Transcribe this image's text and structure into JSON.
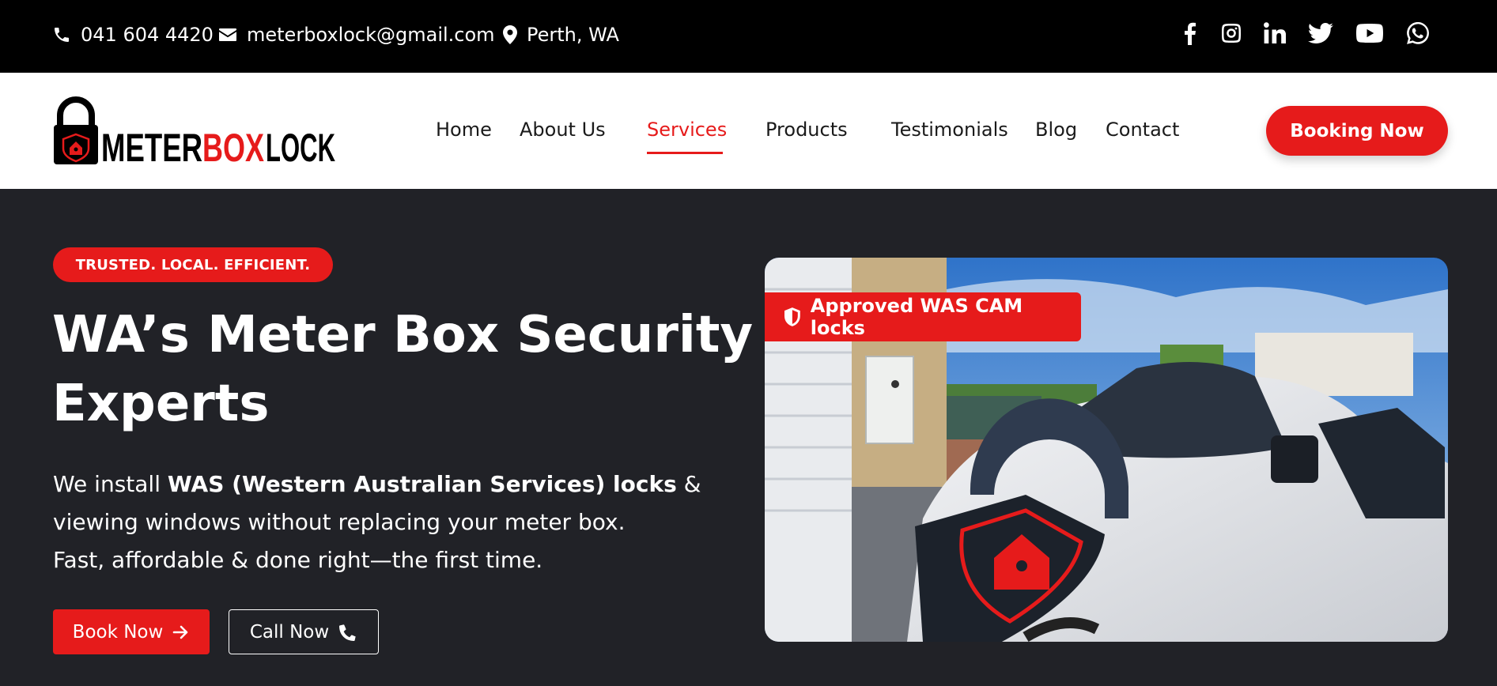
{
  "topbar": {
    "phone": "041 604 4420",
    "email": "meterboxlock@gmail.com",
    "location": "Perth, WA",
    "social": [
      "facebook-icon",
      "instagram-icon",
      "linkedin-icon",
      "twitter-icon",
      "youtube-icon",
      "whatsapp-icon"
    ]
  },
  "header": {
    "logo_text": {
      "part1": "METER",
      "part2": "BOX",
      "part3": "LOCK"
    },
    "nav": [
      {
        "label": "Home"
      },
      {
        "label": "About Us"
      },
      {
        "label": "Services"
      },
      {
        "label": "Products"
      },
      {
        "label": "Testimonials"
      },
      {
        "label": "Blog"
      },
      {
        "label": "Contact"
      }
    ],
    "active_nav": "Services",
    "cta": "Booking Now"
  },
  "hero": {
    "badge": "TRUSTED. LOCAL. EFFICIENT.",
    "title_line1": "WA’s Meter Box Security",
    "title_line2": "Experts",
    "desc_intro": "We install ",
    "desc_bold": "WAS (Western Australian Services) locks",
    "desc_after": " &",
    "desc_line2": "viewing windows without replacing your meter box.",
    "desc_line3": "Fast, affordable & done right—the first time.",
    "btn_book": "Book Now",
    "btn_call": "Call Now",
    "image_badge": "Approved WAS CAM locks"
  },
  "colors": {
    "accent": "#e61b1b",
    "dark_bg": "#212227",
    "topbar_bg": "#000000"
  }
}
